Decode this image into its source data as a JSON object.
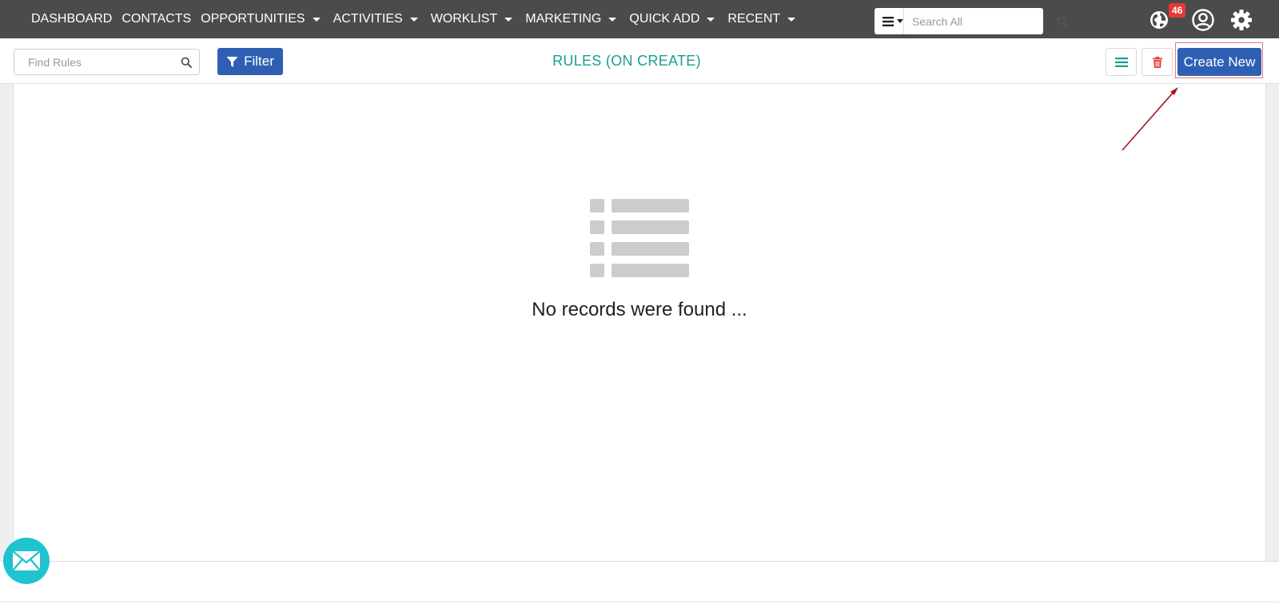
{
  "nav": {
    "items": [
      {
        "label": "DASHBOARD",
        "dropdown": false
      },
      {
        "label": "CONTACTS",
        "dropdown": false
      },
      {
        "label": "OPPORTUNITIES",
        "dropdown": true
      },
      {
        "label": "ACTIVITIES",
        "dropdown": true
      },
      {
        "label": "WORKLIST",
        "dropdown": true
      },
      {
        "label": "MARKETING",
        "dropdown": true
      },
      {
        "label": "QUICK ADD",
        "dropdown": true
      },
      {
        "label": "RECENT",
        "dropdown": true
      }
    ],
    "search_placeholder": "Search All",
    "notification_count": "46"
  },
  "toolbar": {
    "find_placeholder": "Find Rules",
    "filter_label": "Filter",
    "title": "RULES (ON CREATE)",
    "create_label": "Create New"
  },
  "empty_state": {
    "message": "No records were found ..."
  },
  "colors": {
    "nav_bg": "#4b4b4b",
    "primary": "#2f5fb3",
    "title": "#1a9e8f",
    "badge": "#e53935",
    "fab": "#1fc3cf",
    "annotation": "#a3171c"
  },
  "icons": [
    "hamburger-icon",
    "search-icon",
    "globe-icon",
    "user-circle-icon",
    "gear-icon",
    "filter-icon",
    "list-icon",
    "trash-icon",
    "empty-list-icon",
    "mail-icon"
  ]
}
